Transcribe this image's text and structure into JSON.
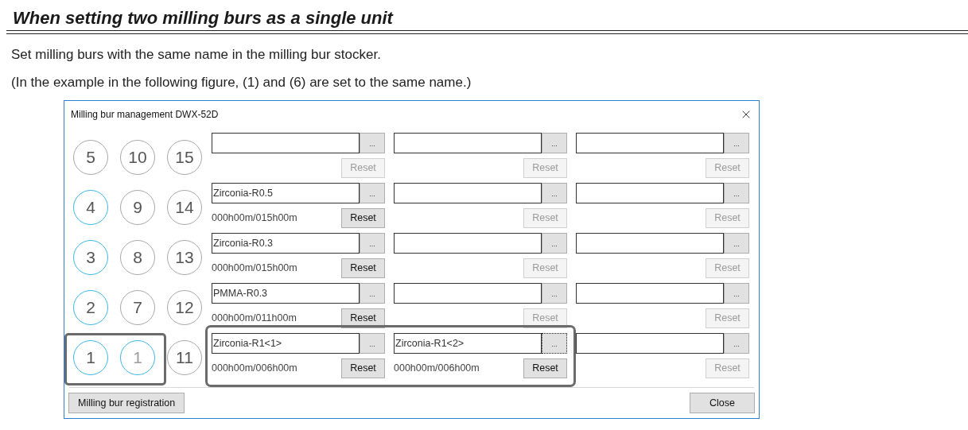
{
  "heading": "When setting two milling burs as a single unit",
  "paragraphs": [
    "Set milling burs with the same name in the milling bur stocker.",
    "(In the example in the following figure, (1) and (6) are set to the same name.)"
  ],
  "dialog": {
    "title": "Milling bur management DWX-52D",
    "circles": [
      {
        "label": "5",
        "set": false,
        "faded": false
      },
      {
        "label": "10",
        "set": false,
        "faded": false
      },
      {
        "label": "15",
        "set": false,
        "faded": false
      },
      {
        "label": "4",
        "set": true,
        "faded": false
      },
      {
        "label": "9",
        "set": false,
        "faded": false
      },
      {
        "label": "14",
        "set": false,
        "faded": false
      },
      {
        "label": "3",
        "set": true,
        "faded": false
      },
      {
        "label": "8",
        "set": false,
        "faded": false
      },
      {
        "label": "13",
        "set": false,
        "faded": false
      },
      {
        "label": "2",
        "set": true,
        "faded": false
      },
      {
        "label": "7",
        "set": false,
        "faded": false
      },
      {
        "label": "12",
        "set": false,
        "faded": false
      },
      {
        "label": "1",
        "set": true,
        "faded": false
      },
      {
        "label": "1",
        "set": true,
        "faded": true
      },
      {
        "label": "11",
        "set": false,
        "faded": false
      }
    ],
    "slots": [
      {
        "browse": "...",
        "reset": "Reset",
        "reset_enabled": false,
        "browse_focused": false
      },
      {
        "browse": "...",
        "reset": "Reset",
        "reset_enabled": false,
        "browse_focused": false
      },
      {
        "browse": "...",
        "reset": "Reset",
        "reset_enabled": false,
        "browse_focused": false
      },
      {
        "name": "Zirconia-R0.5",
        "time": "000h00m/015h00m",
        "browse": "...",
        "reset": "Reset",
        "reset_enabled": true,
        "browse_focused": false
      },
      {
        "browse": "...",
        "reset": "Reset",
        "reset_enabled": false,
        "browse_focused": false
      },
      {
        "browse": "...",
        "reset": "Reset",
        "reset_enabled": false,
        "browse_focused": false
      },
      {
        "name": "Zirconia-R0.3",
        "time": "000h00m/015h00m",
        "browse": "...",
        "reset": "Reset",
        "reset_enabled": true,
        "browse_focused": false
      },
      {
        "browse": "...",
        "reset": "Reset",
        "reset_enabled": false,
        "browse_focused": false
      },
      {
        "browse": "...",
        "reset": "Reset",
        "reset_enabled": false,
        "browse_focused": false
      },
      {
        "name": "PMMA-R0.3",
        "time": "000h00m/011h00m",
        "browse": "...",
        "reset": "Reset",
        "reset_enabled": true,
        "browse_focused": false
      },
      {
        "browse": "...",
        "reset": "Reset",
        "reset_enabled": false,
        "browse_focused": false
      },
      {
        "browse": "...",
        "reset": "Reset",
        "reset_enabled": false,
        "browse_focused": false
      },
      {
        "name": "Zirconia-R1<1>",
        "time": "000h00m/006h00m",
        "browse": "...",
        "reset": "Reset",
        "reset_enabled": true,
        "browse_focused": false
      },
      {
        "name": "Zirconia-R1<2>",
        "time": "000h00m/006h00m",
        "browse": "...",
        "reset": "Reset",
        "reset_enabled": true,
        "browse_focused": true
      },
      {
        "browse": "...",
        "reset": "Reset",
        "reset_enabled": false,
        "browse_focused": false
      }
    ],
    "buttons": [
      "Milling bur registration",
      "Close"
    ]
  }
}
